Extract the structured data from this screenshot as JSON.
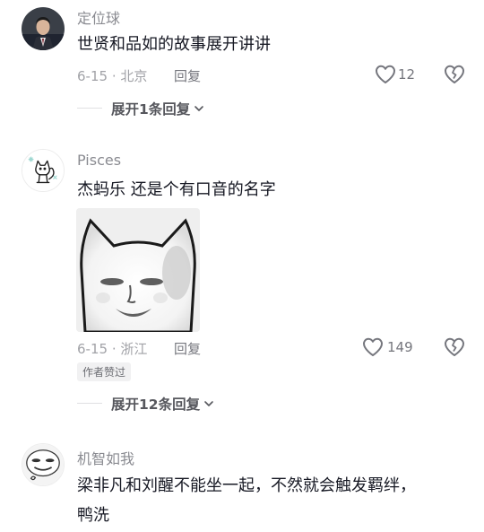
{
  "comments": [
    {
      "username": "定位球",
      "text": "世贤和品如的故事展开讲讲",
      "date": "6-15",
      "location": "北京",
      "reply_label": "回复",
      "likes": "12",
      "expand_label": "展开1条回复"
    },
    {
      "username": "Pisces",
      "text": "杰蚂乐 还是个有口音的名字",
      "date": "6-15",
      "location": "浙江",
      "reply_label": "回复",
      "likes": "149",
      "badge": "作者赞过",
      "expand_label": "展开12条回复"
    },
    {
      "username": "机智如我",
      "text_line1": "梁非凡和刘醒不能坐一起，不然就会触发羁绊，",
      "text_line2": "鸭洗"
    }
  ],
  "colors": {
    "text": "#161823",
    "meta": "#a1a2a7",
    "username": "#8a8b91"
  },
  "icons": [
    "heart-icon",
    "broken-heart-icon",
    "chevron-down-icon"
  ]
}
